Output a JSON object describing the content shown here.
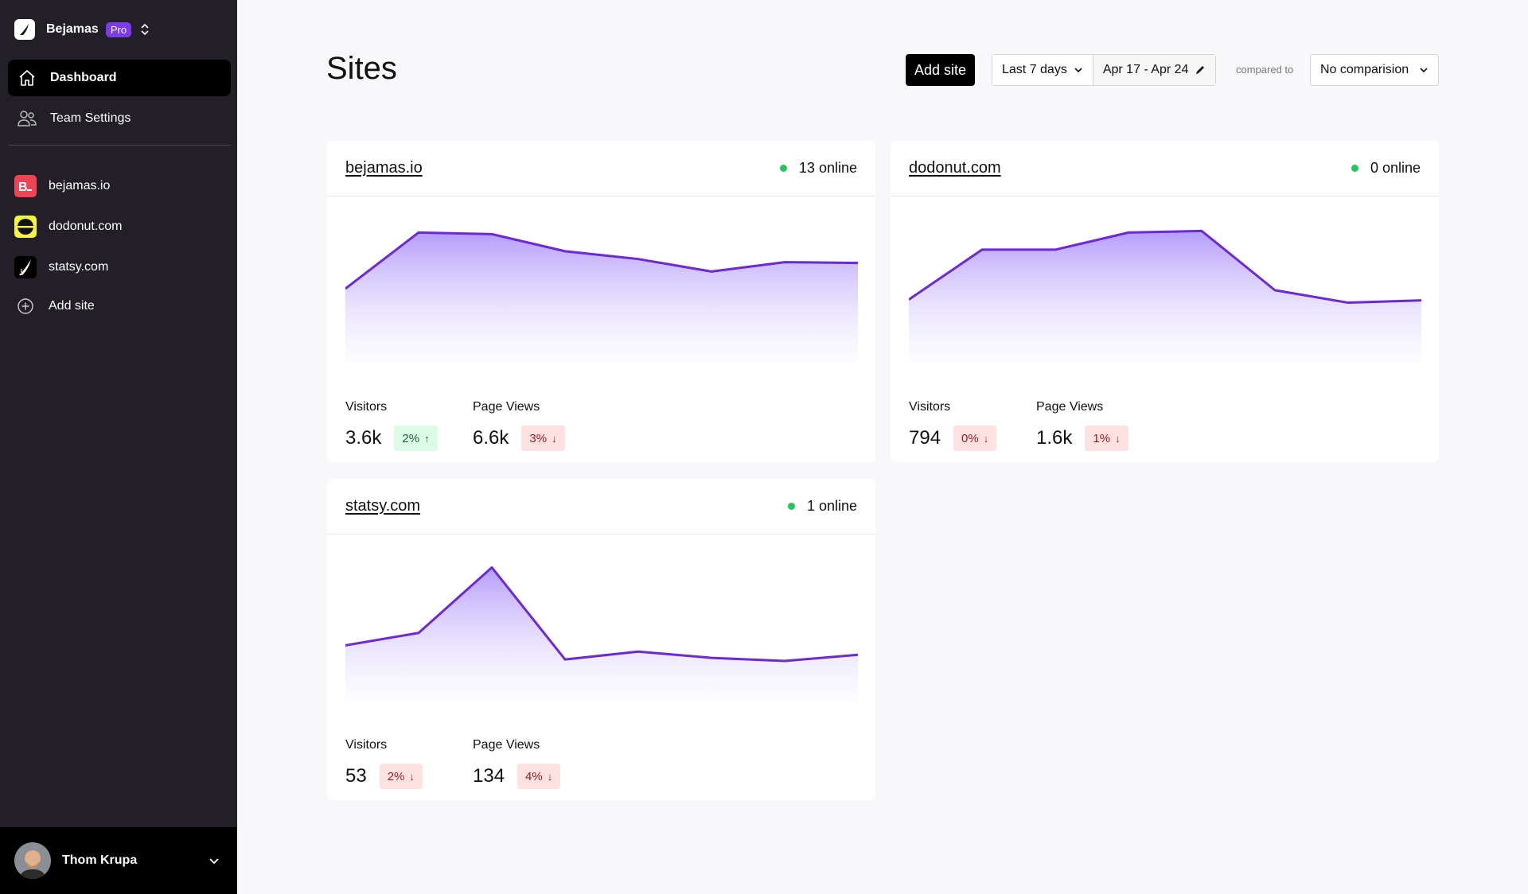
{
  "team": {
    "name": "Bejamas",
    "plan": "Pro"
  },
  "nav": [
    {
      "label": "Dashboard",
      "icon": "home-icon",
      "active": true
    },
    {
      "label": "Team Settings",
      "icon": "users-icon",
      "active": false
    }
  ],
  "sidebar_sites": [
    {
      "label": "bejamas.io",
      "icon": "bejamas-favicon",
      "color": "#ef4456"
    },
    {
      "label": "dodonut.com",
      "icon": "dodonut-favicon",
      "color": "#f5f542"
    },
    {
      "label": "statsy.com",
      "icon": "statsy-favicon",
      "color": "#000000"
    }
  ],
  "add_site_nav": "Add site",
  "user": {
    "name": "Thom Krupa"
  },
  "header": {
    "title": "Sites",
    "add_site": "Add site",
    "range": "Last 7 days",
    "dates": "Apr 17 - Apr 24",
    "compared_label": "compared to",
    "comparison": "No comparision"
  },
  "labels": {
    "visitors": "Visitors",
    "page_views": "Page Views"
  },
  "accent": "#6d28d9",
  "cards": [
    {
      "site": "bejamas.io",
      "online": "13 online",
      "visitors": "3.6k",
      "visitors_change": "2%",
      "visitors_dir": "up",
      "views": "6.6k",
      "views_change": "3%",
      "views_dir": "down",
      "chart_data": {
        "type": "area",
        "values": [
          48,
          84,
          83,
          72,
          67,
          59,
          65,
          64.5
        ],
        "ylim": [
          0,
          100
        ]
      }
    },
    {
      "site": "dodonut.com",
      "online": "0 online",
      "visitors": "794",
      "visitors_change": "0%",
      "visitors_dir": "down",
      "views": "1.6k",
      "views_change": "1%",
      "views_dir": "down",
      "chart_data": {
        "type": "area",
        "values": [
          41,
          73,
          73,
          84,
          85,
          47,
          39,
          40.5
        ],
        "ylim": [
          0,
          100
        ]
      }
    },
    {
      "site": "statsy.com",
      "online": "1 online",
      "visitors": "53",
      "visitors_change": "2%",
      "visitors_dir": "down",
      "views": "134",
      "views_change": "4%",
      "views_dir": "down",
      "chart_data": {
        "type": "area",
        "values": [
          36,
          44,
          86,
          27,
          32,
          28,
          26,
          30
        ],
        "ylim": [
          0,
          100
        ]
      }
    }
  ]
}
